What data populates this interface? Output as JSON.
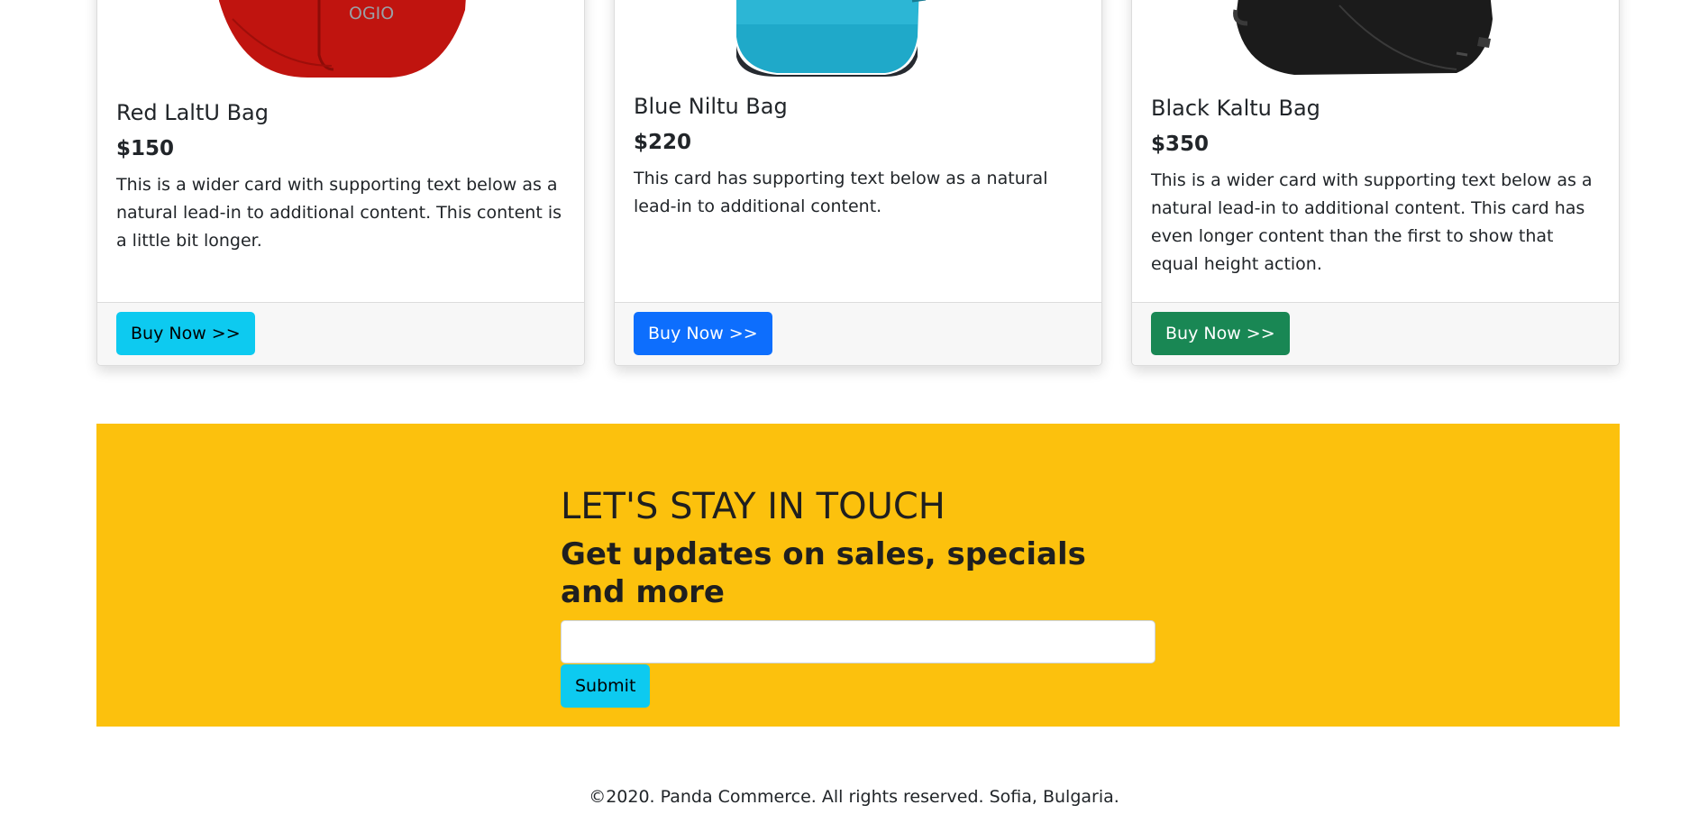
{
  "products": [
    {
      "title": "Red LaltU Bag",
      "price": "$150",
      "text": "This is a wider card with supporting text below as a natural lead-in to additional content. This content is a little bit longer.",
      "button_label": "Buy Now >>",
      "button_color": "#0dcaf0",
      "button_text_color": "#000000",
      "bag_color": "#c0140f",
      "bag_brand": "OGIO"
    },
    {
      "title": "Blue Niltu Bag",
      "price": "$220",
      "text": "This card has supporting text below as a natural lead-in to additional content.",
      "button_label": "Buy Now >>",
      "button_color": "#0d6efd",
      "button_text_color": "#ffffff",
      "bag_color": "#1fa9c9"
    },
    {
      "title": "Black Kaltu Bag",
      "price": "$350",
      "text": "This is a wider card with supporting text below as a natural lead-in to additional content. This card has even longer content than the first to show that equal height action.",
      "button_label": "Buy Now >>",
      "button_color": "#198754",
      "button_text_color": "#ffffff",
      "bag_color": "#1b1b1b"
    }
  ],
  "newsletter": {
    "title": "LET'S STAY IN TOUCH",
    "subtitle": "Get updates on sales, specials and more",
    "input_value": "",
    "submit_label": "Submit",
    "background_color": "#fcc10d"
  },
  "footer": {
    "text": "©2020. Panda Commerce. All rights reserved. Sofia, Bulgaria."
  }
}
